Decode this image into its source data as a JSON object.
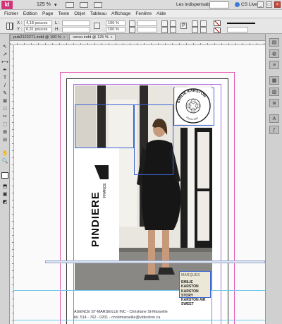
{
  "app": {
    "logo": "Id",
    "zoom": "125 %",
    "workspace": "Les indispensables",
    "cs_live": "CS Live",
    "min": "_",
    "max": "□",
    "close": "×"
  },
  "menu": [
    "Fichier",
    "Edition",
    "Page",
    "Texte",
    "Objet",
    "Tableau",
    "Affichage",
    "Fenêtre",
    "Aide"
  ],
  "control": {
    "x_label": "X :",
    "y_label": "Y :",
    "x_value": "4,18 pouces",
    "y_value": "6,31 pouces",
    "w_label": "L :",
    "h_label": "H :",
    "zoom_pct": "100 %",
    "angle_pct": "100 %"
  },
  "tabs": [
    {
      "label": "pub2123271.indd @ 100 %",
      "close": "x"
    },
    {
      "label": "verso.indd @ 125 %",
      "close": "x"
    }
  ],
  "toolbox": {
    "tools": [
      "↖",
      "↗",
      "⟷",
      "✒",
      "T",
      "/",
      "✎",
      "⊠",
      "□",
      "✂",
      "⬚",
      "⊞",
      "⊟",
      "✋",
      "🔍",
      "⬒",
      "▣",
      "◩"
    ]
  },
  "panels": [
    "▤",
    "◍",
    "≡",
    "▦",
    "▥",
    "≣",
    "A",
    "ƒ"
  ],
  "document": {
    "brand_logo": "PINDIERE",
    "brand_sub": "FRANCE",
    "seal_text": "EMILIE KARSTON",
    "seal_sub": "Depuis 1987",
    "marques_title": "MARQUES",
    "marques_lines": [
      "EMILIE KARSTON",
      "KARSTON STORY",
      "KARSTON AIR",
      "SWEET"
    ],
    "footer_line1": "AGENCE ST-MARSEILLE INC - Christiane St-Marseille",
    "footer_line2": "tél. 514 - 762 - 0201 - christmarseille@videotron.ca"
  }
}
